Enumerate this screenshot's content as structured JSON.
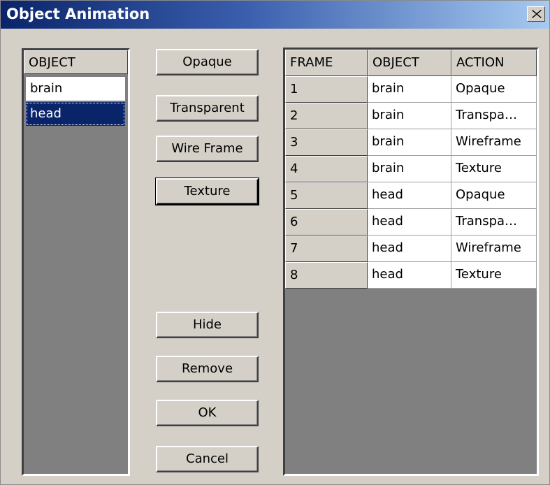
{
  "window": {
    "title": "Object Animation",
    "close_icon": "close-icon"
  },
  "object_list": {
    "header": "OBJECT",
    "items": [
      {
        "label": "brain",
        "selected": false
      },
      {
        "label": "head",
        "selected": true
      }
    ]
  },
  "buttons": {
    "opaque": "Opaque",
    "transparent": "Transparent",
    "wire_frame": "Wire Frame",
    "texture": "Texture",
    "hide": "Hide",
    "remove": "Remove",
    "ok": "OK",
    "cancel": "Cancel"
  },
  "table": {
    "columns": [
      "FRAME",
      "OBJECT",
      "ACTION"
    ],
    "rows": [
      [
        "1",
        "brain",
        "Opaque"
      ],
      [
        "2",
        "brain",
        "Transpa…"
      ],
      [
        "3",
        "brain",
        "Wireframe"
      ],
      [
        "4",
        "brain",
        "Texture"
      ],
      [
        "5",
        "head",
        "Opaque"
      ],
      [
        "6",
        "head",
        "Transpa…"
      ],
      [
        "7",
        "head",
        "Wireframe"
      ],
      [
        "8",
        "head",
        "Texture"
      ]
    ]
  },
  "colors": {
    "title_start": "#0a246a",
    "title_end": "#a6caf0",
    "selection": "#0a246a",
    "face": "#d4d0c8",
    "empty_area": "#808080"
  }
}
